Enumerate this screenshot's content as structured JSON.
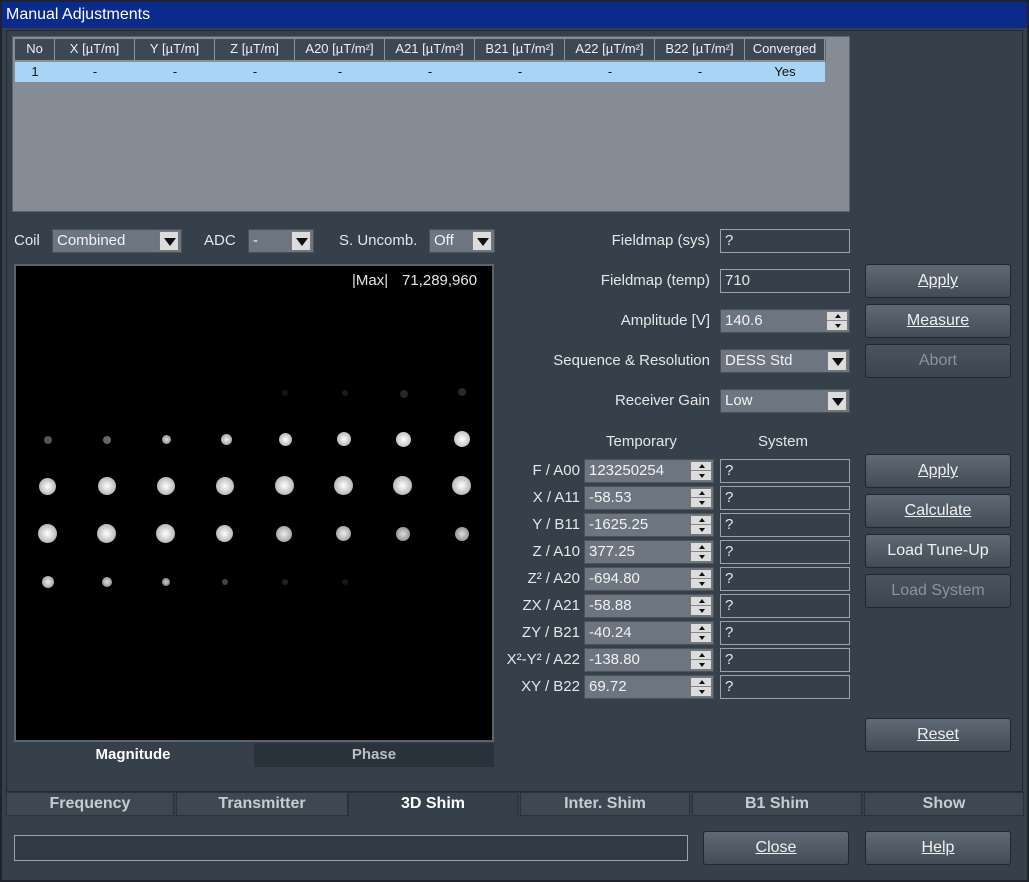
{
  "window": {
    "title": "Manual Adjustments"
  },
  "table": {
    "headers": [
      "No",
      "X [µT/m]",
      "Y [µT/m]",
      "Z [µT/m]",
      "A20 [µT/m²]",
      "A21 [µT/m²]",
      "B21 [µT/m²]",
      "A22 [µT/m²]",
      "B22 [µT/m²]",
      "Converged"
    ],
    "rows": [
      [
        "1",
        "-",
        "-",
        "-",
        "-",
        "-",
        "-",
        "-",
        "-",
        "Yes"
      ]
    ]
  },
  "controls": {
    "coil_label": "Coil",
    "coil_value": "Combined",
    "adc_label": "ADC",
    "adc_value": "-",
    "suncomb_label": "S. Uncomb.",
    "suncomb_value": "Off"
  },
  "viewer": {
    "max_label": "|Max|",
    "max_value": "71,289,960",
    "tab_magnitude": "Magnitude",
    "tab_phase": "Phase"
  },
  "form": {
    "fieldmap_sys_label": "Fieldmap (sys)",
    "fieldmap_sys_value": "?",
    "fieldmap_temp_label": "Fieldmap (temp)",
    "fieldmap_temp_value": "710",
    "amplitude_label": "Amplitude [V]",
    "amplitude_value": "140.6",
    "sequence_label": "Sequence & Resolution",
    "sequence_value": "DESS Std",
    "receiver_gain_label": "Receiver Gain",
    "receiver_gain_value": "Low"
  },
  "shim": {
    "temporary_header": "Temporary",
    "system_header": "System",
    "rows": [
      {
        "label": "F / A00",
        "temp": "123250254",
        "system": "?"
      },
      {
        "label": "X / A11",
        "temp": "-58.53",
        "system": "?"
      },
      {
        "label": "Y / B11",
        "temp": "-1625.25",
        "system": "?"
      },
      {
        "label": "Z / A10",
        "temp": "377.25",
        "system": "?"
      },
      {
        "label": "Z² / A20",
        "temp": "-694.80",
        "system": "?"
      },
      {
        "label": "ZX / A21",
        "temp": "-58.88",
        "system": "?"
      },
      {
        "label": "ZY / B21",
        "temp": "-40.24",
        "system": "?"
      },
      {
        "label": "X²-Y² / A22",
        "temp": "-138.80",
        "system": "?"
      },
      {
        "label": "XY / B22",
        "temp": "69.72",
        "system": "?"
      }
    ]
  },
  "buttons": {
    "apply_top": "Apply",
    "measure": "Measure",
    "abort": "Abort",
    "apply_shim": "Apply",
    "calculate": "Calculate",
    "load_tuneup": "Load Tune-Up",
    "load_system": "Load System",
    "reset": "Reset",
    "close": "Close",
    "help": "Help"
  },
  "tabs": [
    "Frequency",
    "Transmitter",
    "3D Shim",
    "Inter. Shim",
    "B1 Shim",
    "Show"
  ],
  "active_tab": "3D Shim"
}
